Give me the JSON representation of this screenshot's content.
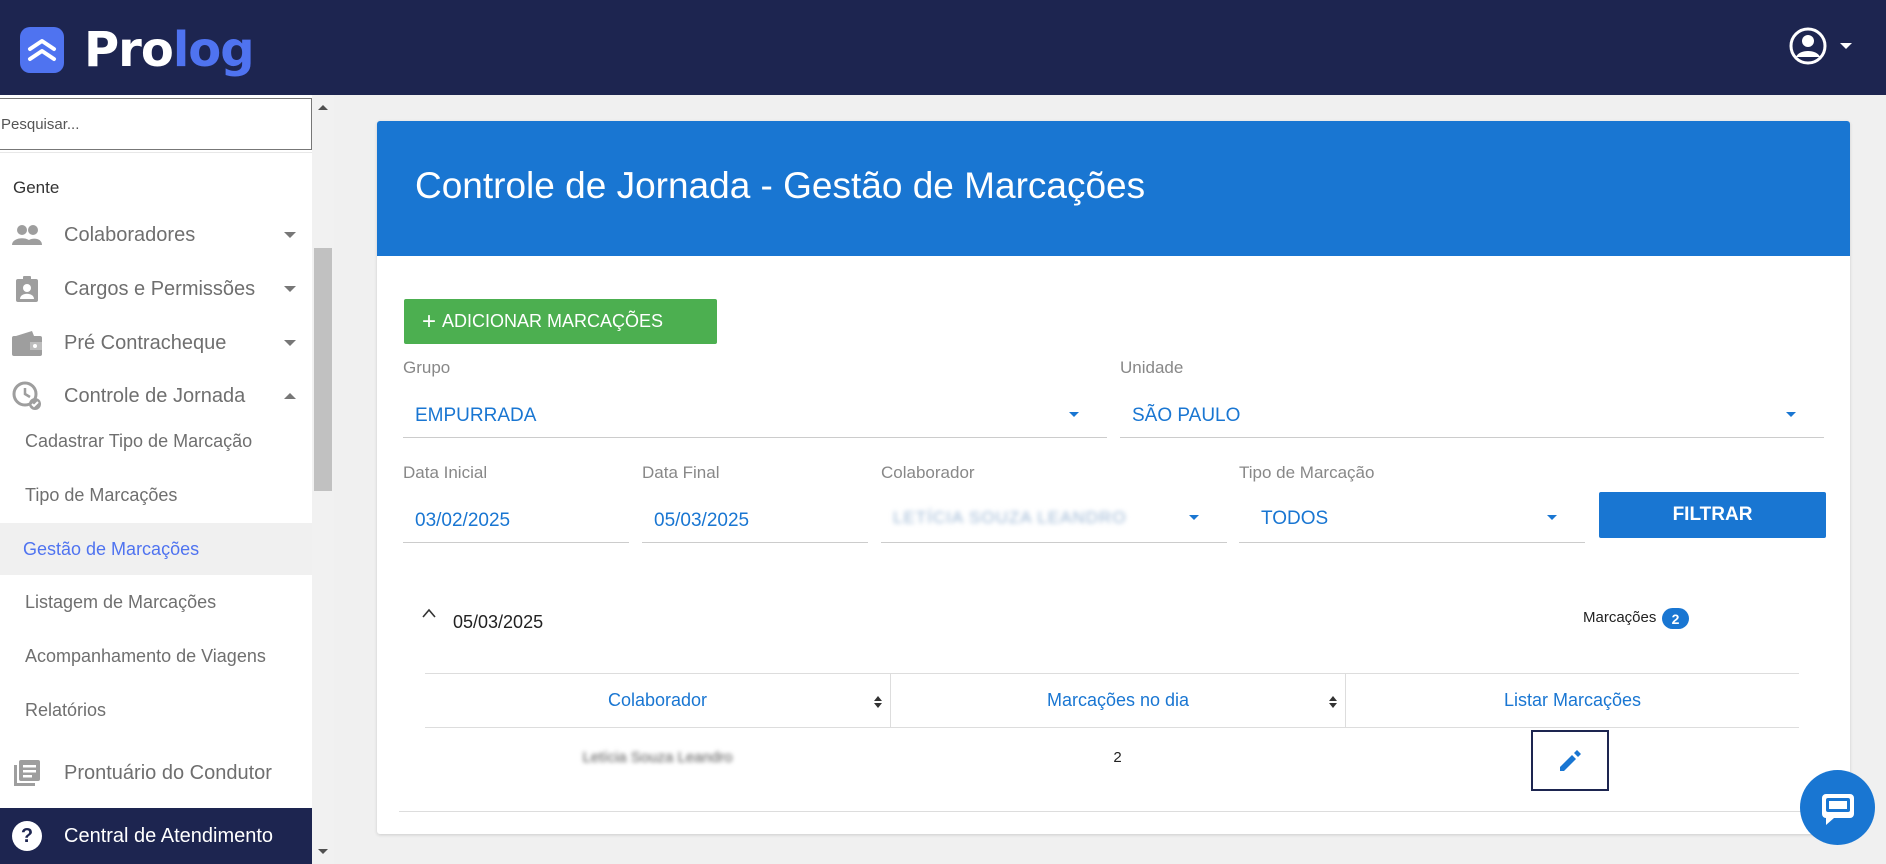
{
  "app": {
    "logo_part1": "Pro",
    "logo_part2": "log"
  },
  "colors": {
    "topbar": "#1d2550",
    "accent": "#1976d2",
    "brand": "#4f73f0",
    "add_button": "#4caf50"
  },
  "sidebar": {
    "search_placeholder": "Pesquisar...",
    "section_title": "Gente",
    "items": [
      {
        "label": "Colaboradores",
        "icon": "people-icon"
      },
      {
        "label": "Cargos e Permissões",
        "icon": "badge-icon"
      },
      {
        "label": "Pré Contracheque",
        "icon": "wallet-icon"
      },
      {
        "label": "Controle de Jornada",
        "icon": "clock-icon"
      }
    ],
    "sub_items": [
      {
        "label": "Cadastrar Tipo de Marcação"
      },
      {
        "label": "Tipo de Marcações"
      },
      {
        "label": "Gestão de Marcações"
      },
      {
        "label": "Listagem de Marcações"
      },
      {
        "label": "Acompanhamento de Viagens"
      },
      {
        "label": "Relatórios"
      }
    ],
    "extra_item": {
      "label": "Prontuário do Condutor",
      "icon": "document-icon"
    },
    "help_label": "Central de Atendimento"
  },
  "main": {
    "title": "Controle de Jornada - Gestão de Marcações",
    "add_button_label": "ADICIONAR MARCAÇÕES",
    "filters": {
      "grupo_label": "Grupo",
      "grupo_value": "EMPURRADA",
      "unidade_label": "Unidade",
      "unidade_value": "SÃO PAULO",
      "data_inicial_label": "Data Inicial",
      "data_inicial_value": "03/02/2025",
      "data_final_label": "Data Final",
      "data_final_value": "05/03/2025",
      "colaborador_label": "Colaborador",
      "colaborador_value": "LETÍCIA SOUZA LEANDRO",
      "tipo_label": "Tipo de Marcação",
      "tipo_value": "TODOS",
      "filter_button_label": "FILTRAR"
    },
    "group": {
      "date": "05/03/2025",
      "count_label": "Marcações",
      "count": "2"
    },
    "table": {
      "headers": [
        "Colaborador",
        "Marcações no dia",
        "Listar Marcações"
      ],
      "rows": [
        {
          "colaborador": "Letícia Souza Leandro",
          "marcacoes": "2"
        }
      ]
    }
  }
}
